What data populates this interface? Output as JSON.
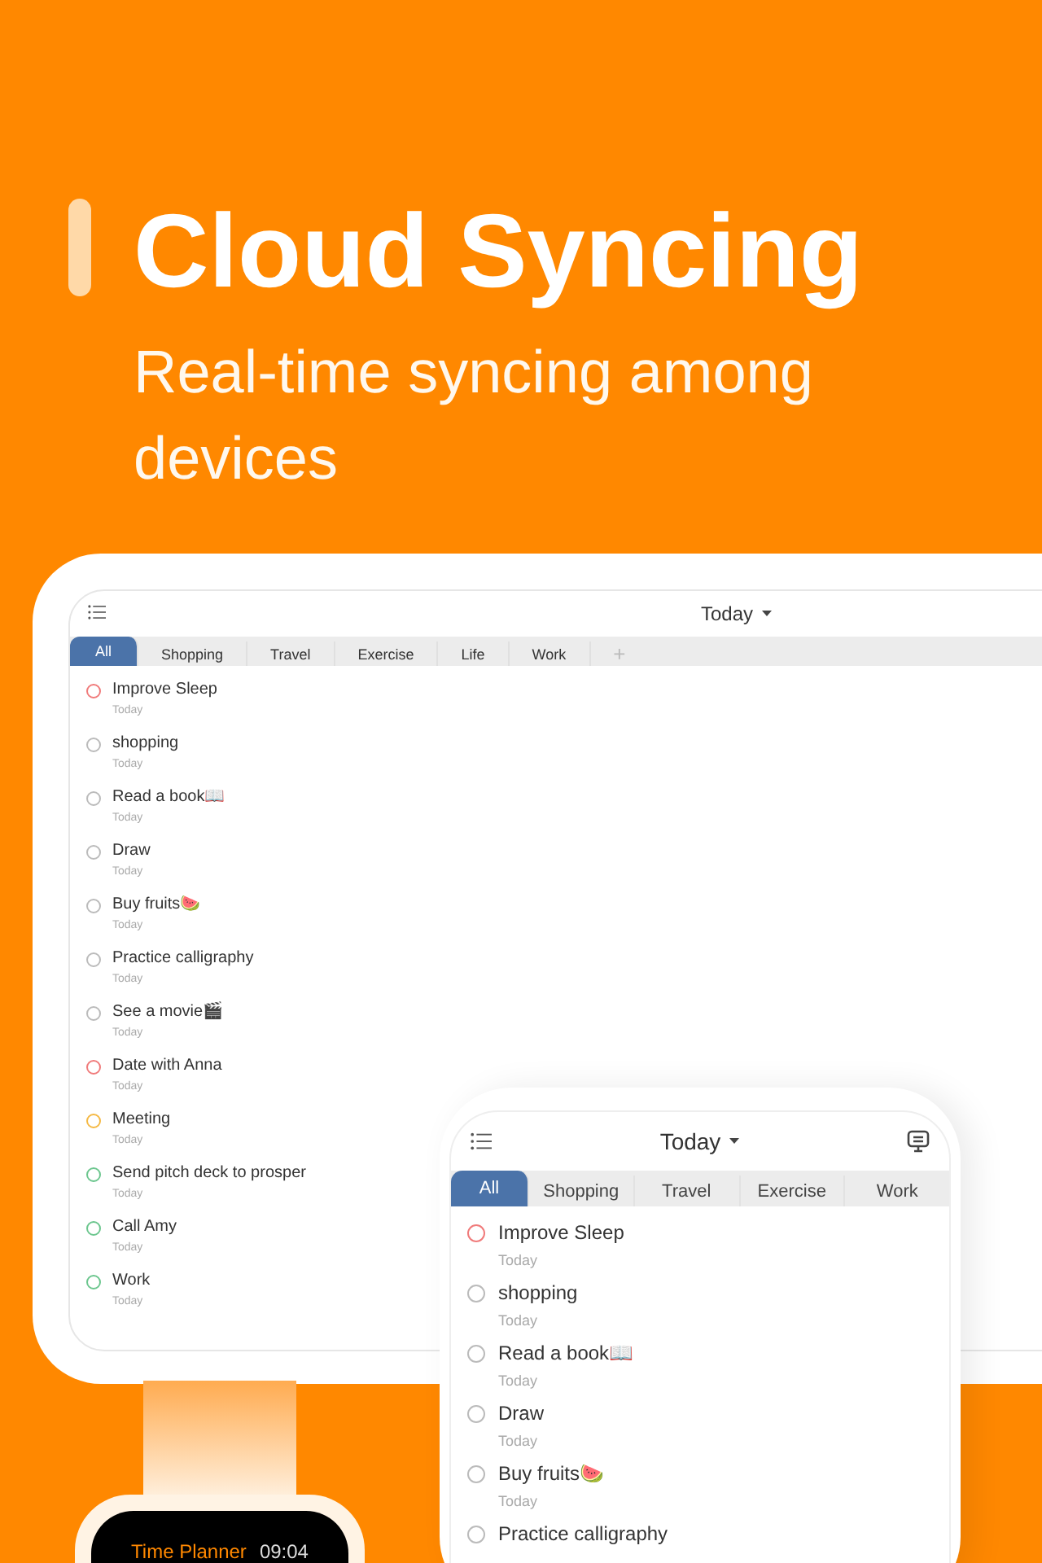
{
  "headline": {
    "title": "Cloud Syncing",
    "subtitle": "Real-time syncing among devices"
  },
  "tablet": {
    "title": "Today",
    "tabs": [
      {
        "label": "All",
        "selected": true
      },
      {
        "label": "Shopping",
        "selected": false
      },
      {
        "label": "Travel",
        "selected": false
      },
      {
        "label": "Exercise",
        "selected": false
      },
      {
        "label": "Life",
        "selected": false
      },
      {
        "label": "Work",
        "selected": false
      }
    ],
    "add_tab": "+",
    "tasks": [
      {
        "title": "Improve Sleep",
        "due": "Today",
        "color": "#f07b7b"
      },
      {
        "title": "shopping",
        "due": "Today",
        "color": "#bbbbbb"
      },
      {
        "title": "Read a book📖",
        "due": "Today",
        "color": "#bbbbbb"
      },
      {
        "title": "Draw",
        "due": "Today",
        "color": "#bbbbbb"
      },
      {
        "title": "Buy fruits🍉",
        "due": "Today",
        "color": "#bbbbbb"
      },
      {
        "title": "Practice calligraphy",
        "due": "Today",
        "color": "#bbbbbb"
      },
      {
        "title": "See a movie🎬",
        "due": "Today",
        "color": "#bbbbbb"
      },
      {
        "title": "Date with Anna",
        "due": "Today",
        "color": "#f07b7b"
      },
      {
        "title": "Meeting",
        "due": "Today",
        "color": "#f5b944"
      },
      {
        "title": "Send pitch deck to prosper",
        "due": "Today",
        "color": "#6cc68e"
      },
      {
        "title": "Call Amy",
        "due": "Today",
        "color": "#6cc68e"
      },
      {
        "title": "Work",
        "due": "Today",
        "color": "#6cc68e"
      }
    ]
  },
  "phone": {
    "title": "Today",
    "tabs": [
      {
        "label": "All",
        "selected": true
      },
      {
        "label": "Shopping",
        "selected": false
      },
      {
        "label": "Travel",
        "selected": false
      },
      {
        "label": "Exercise",
        "selected": false
      },
      {
        "label": "Work",
        "selected": false
      }
    ],
    "tasks": [
      {
        "title": "Improve Sleep",
        "due": "Today",
        "color": "#f07b7b"
      },
      {
        "title": "shopping",
        "due": "Today",
        "color": "#bbbbbb"
      },
      {
        "title": "Read a book📖",
        "due": "Today",
        "color": "#bbbbbb"
      },
      {
        "title": "Draw",
        "due": "Today",
        "color": "#bbbbbb"
      },
      {
        "title": "Buy fruits🍉",
        "due": "Today",
        "color": "#bbbbbb"
      },
      {
        "title": "Practice calligraphy",
        "color": "#bbbbbb"
      }
    ]
  },
  "watch": {
    "app_name": "Time Planner",
    "time": "09:04"
  }
}
